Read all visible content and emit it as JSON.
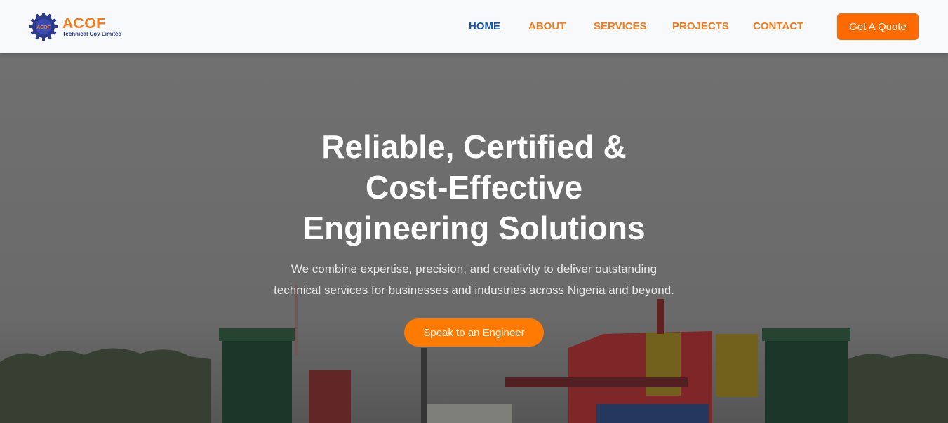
{
  "brand": {
    "name": "ACOF",
    "tagline": "Technical Coy Limited",
    "emblem_text": "ACOF",
    "logo_icon": "gear-logo-icon"
  },
  "nav": {
    "items": [
      {
        "label": "HOME",
        "active": true
      },
      {
        "label": "ABOUT",
        "active": false
      },
      {
        "label": "SERVICES",
        "active": false
      },
      {
        "label": "PROJECTS",
        "active": false
      },
      {
        "label": "CONTACT",
        "active": false
      }
    ],
    "cta_label": "Get A Quote"
  },
  "hero": {
    "title_lines": [
      "Reliable, Certified &",
      "Cost-Effective",
      "Engineering Solutions"
    ],
    "subtitle_lines": [
      "We combine expertise, precision, and creativity to deliver outstanding",
      "technical services for businesses and industries across Nigeria and beyond."
    ],
    "cta_label": "Speak to an Engineer"
  },
  "colors": {
    "accent_orange": "#ff6a00",
    "nav_orange": "#f07c1c",
    "nav_active_blue": "#1453a6",
    "header_bg": "#f8f9fb"
  }
}
